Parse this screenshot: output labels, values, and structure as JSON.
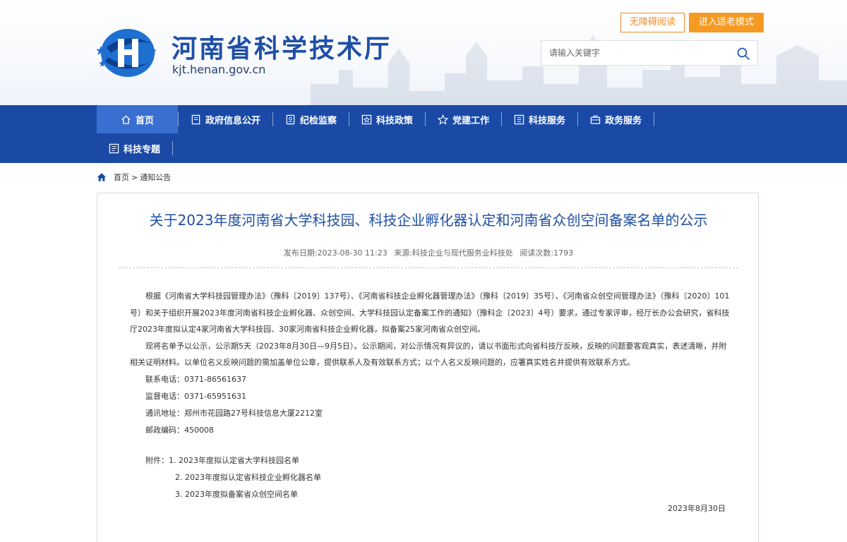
{
  "header": {
    "site_title": "河南省科学技术厅",
    "site_url": "kjt.henan.gov.cn",
    "accessibility_label": "无障碍阅读",
    "elder_mode_label": "进入适老模式",
    "search_placeholder": "请输入关键字"
  },
  "nav": {
    "items": [
      {
        "label": "首页",
        "icon": "home-icon"
      },
      {
        "label": "政府信息公开",
        "icon": "document-icon"
      },
      {
        "label": "纪检监察",
        "icon": "badge-icon"
      },
      {
        "label": "科技政策",
        "icon": "star-box-icon"
      },
      {
        "label": "党建工作",
        "icon": "star-icon"
      },
      {
        "label": "科技服务",
        "icon": "grid-icon"
      },
      {
        "label": "政务服务",
        "icon": "briefcase-icon"
      },
      {
        "label": "科技专题",
        "icon": "list-icon"
      }
    ]
  },
  "breadcrumb": {
    "home": "首页",
    "sep": ">",
    "current": "通知公告"
  },
  "article": {
    "title": "关于2023年度河南省大学科技园、科技企业孵化器认定和河南省众创空间备案名单的公示",
    "publish_label": "发布日期:",
    "publish_date": "2023-08-30 11:23",
    "source_label": "来源:",
    "source": "科技企业与现代服务业科技处",
    "views_label": "阅读次数:",
    "views": "1793",
    "para1": "根据《河南省大学科技园管理办法》（豫科〔2019〕137号）、《河南省科技企业孵化器管理办法》（豫科〔2019〕35号）、《河南省众创空间管理办法》（豫科〔2020〕101号）和关于组织开展2023年度河南省科技企业孵化器、众创空间、大学科技园认定备案工作的通知》（豫科企〔2023〕4号）要求，通过专家评审，经厅长办公会研究，省科技厅2023年度拟认定4家河南省大学科技园、30家河南省科技企业孵化器，拟备案25家河南省众创空间。",
    "para2": "现将名单予以公示，公示期5天（2023年8月30日—9月5日）。公示期间，对公示情况有异议的，请以书面形式向省科技厅反映，反映的问题要客观真实，表述清晰，并附相关证明材料。以单位名义反映问题的需加盖单位公章，提供联系人及有效联系方式；以个人名义反映问题的，应署真实姓名并提供有效联系方式。",
    "contact_phone": "联系电话：0371-86561637",
    "supervise_phone": "监督电话：0371-65951631",
    "address": "通讯地址：郑州市花园路27号科技信息大厦2212室",
    "postcode": "邮政编码：450008",
    "attachments": [
      "附件：1. 2023年度拟认定省大学科技园名单",
      "2. 2023年度拟认定省科技企业孵化器名单",
      "3. 2023年度拟备案省众创空间名单"
    ],
    "sign_date": "2023年8月30日"
  },
  "colors": {
    "brand_blue": "#1a4aa6",
    "title_blue": "#1e4fa6",
    "accent_orange": "#f59a23"
  }
}
